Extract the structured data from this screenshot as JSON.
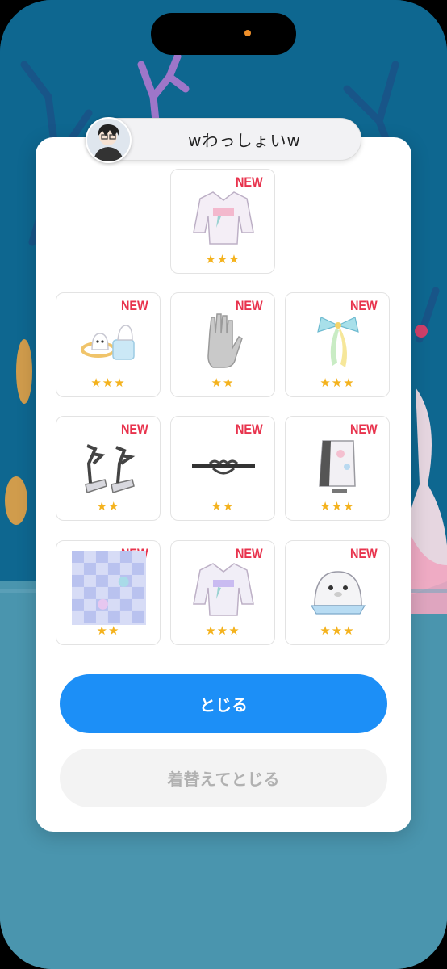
{
  "user": {
    "name": "wわっしょいw",
    "avatar_icon": "avatar-icon"
  },
  "items": [
    {
      "new_label": "NEW",
      "stars": "★★★",
      "icon": "kimono-top-icon"
    },
    {
      "new_label": "NEW",
      "stars": "★★★",
      "icon": "ghost-float-accessory-icon"
    },
    {
      "new_label": "NEW",
      "stars": "★★",
      "icon": "glove-icon"
    },
    {
      "new_label": "NEW",
      "stars": "★★★",
      "icon": "ribbon-bow-icon"
    },
    {
      "new_label": "NEW",
      "stars": "★★",
      "icon": "geta-sandals-icon"
    },
    {
      "new_label": "NEW",
      "stars": "★★",
      "icon": "choker-icon"
    },
    {
      "new_label": "NEW",
      "stars": "★★★",
      "icon": "skirt-icon"
    },
    {
      "new_label": "NEW",
      "stars": "★★",
      "icon": "checker-pattern-icon"
    },
    {
      "new_label": "NEW",
      "stars": "★★★",
      "icon": "kimono-top-icon"
    },
    {
      "new_label": "NEW",
      "stars": "★★★",
      "icon": "seal-plush-icon"
    }
  ],
  "buttons": {
    "close": "とじる",
    "change_close": "着替えてとじる"
  },
  "colors": {
    "primary": "#1c8ff7",
    "new_badge": "#e8334d",
    "star": "#f4b21d"
  }
}
